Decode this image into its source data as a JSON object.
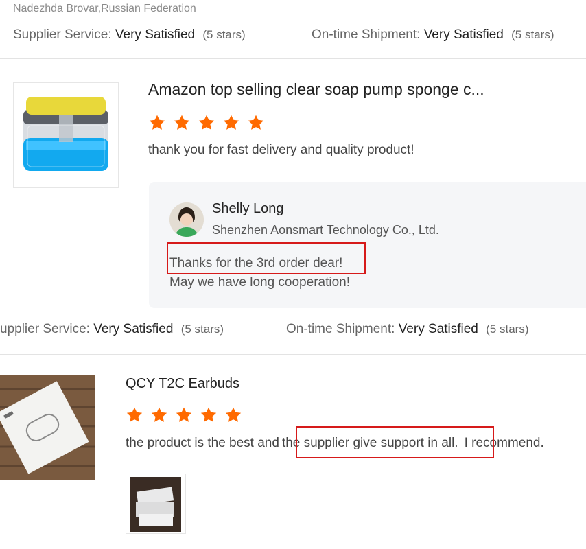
{
  "review_top": {
    "reviewer": "Nadezhda Brovar,Russian Federation",
    "supplier_service_label": "Supplier Service:",
    "supplier_service_value": "Very Satisfied",
    "supplier_service_stars": "(5 stars)",
    "shipment_label": "On-time Shipment:",
    "shipment_value": "Very Satisfied",
    "shipment_stars": "(5 stars)"
  },
  "review_1": {
    "product_title": "Amazon top selling clear soap pump sponge c...",
    "rating": 5,
    "comment": "thank you for fast delivery and quality product!",
    "reply": {
      "name": "Shelly Long",
      "company": "Shenzhen Aonsmart Technology Co., Ltd.",
      "line1": "Thanks for the 3rd order dear!",
      "line2": "May we have long cooperation!"
    },
    "supplier_service_label": "upplier Service:",
    "supplier_service_value": "Very Satisfied",
    "supplier_service_stars": "(5 stars)",
    "shipment_label": "On-time Shipment:",
    "shipment_value": "Very Satisfied",
    "shipment_stars": "(5 stars)"
  },
  "review_2": {
    "product_title": "QCY T2C Earbuds",
    "rating": 5,
    "comment_part1": "the product is the best and",
    "comment_highlight": "the supplier give support in all.",
    "comment_part2": "I recommend."
  },
  "colors": {
    "star": "#ff6a00",
    "highlight_border": "#d61a1a",
    "reply_bg": "#f5f6f8"
  },
  "icons": {
    "star": "star-icon"
  }
}
